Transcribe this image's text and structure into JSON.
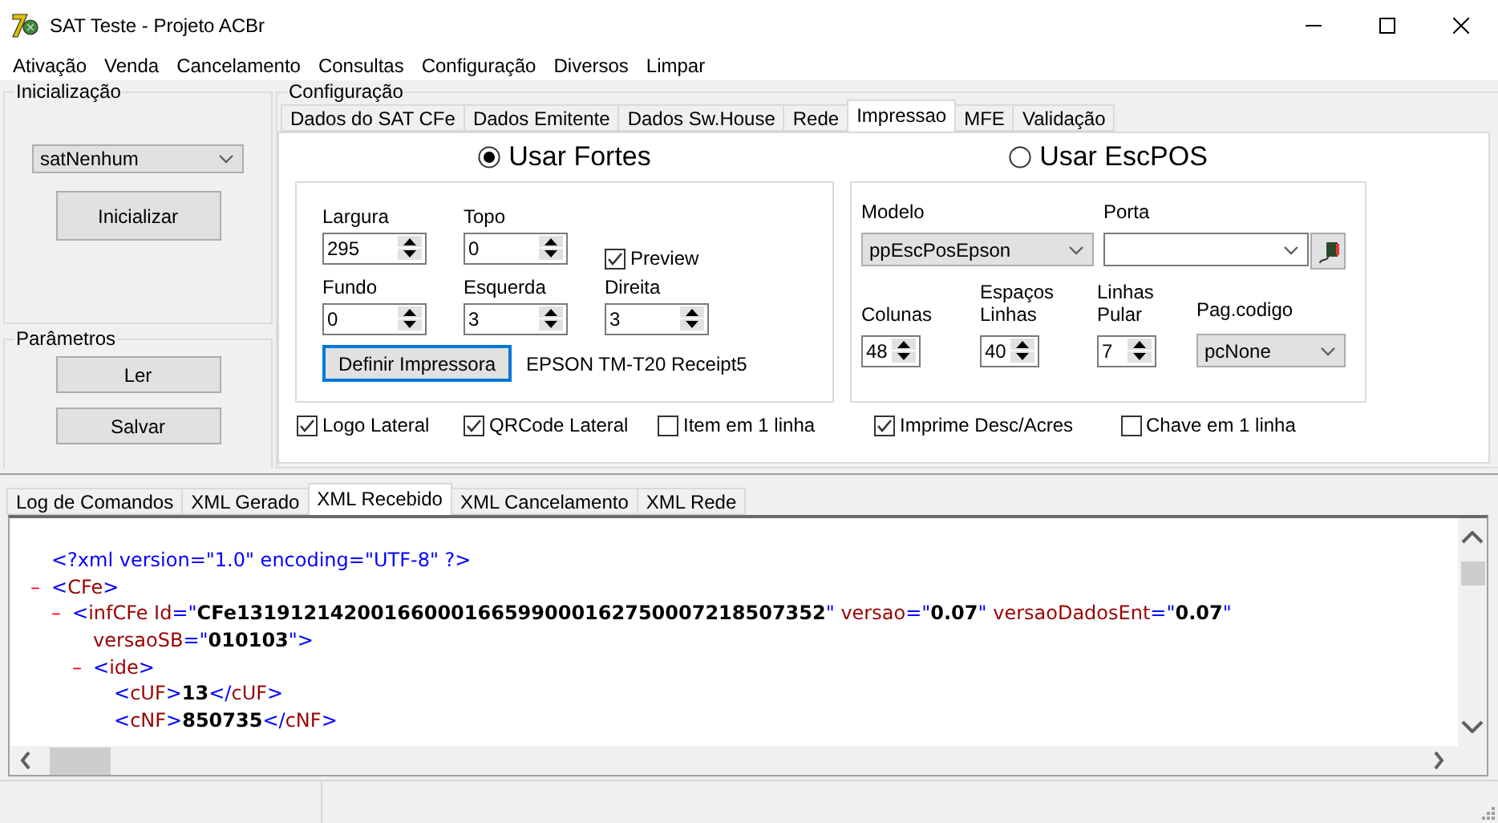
{
  "window": {
    "title": "SAT Teste - Projeto ACBr"
  },
  "menu": [
    "Ativação",
    "Venda",
    "Cancelamento",
    "Consultas",
    "Configuração",
    "Diversos",
    "Limpar"
  ],
  "initialization": {
    "title": "Inicialização",
    "model": "satNenhum",
    "button": "Inicializar"
  },
  "parameters": {
    "title": "Parâmetros",
    "buttons": [
      "Ler",
      "Salvar"
    ]
  },
  "configuration": {
    "title": "Configuração",
    "tabs": [
      {
        "label": "Dados do SAT CFe",
        "selected": false
      },
      {
        "label": "Dados Emitente",
        "selected": false
      },
      {
        "label": "Dados Sw.House",
        "selected": false
      },
      {
        "label": "Rede",
        "selected": false
      },
      {
        "label": "Impressao",
        "selected": true
      },
      {
        "label": "MFE",
        "selected": false
      },
      {
        "label": "Validação",
        "selected": false
      }
    ],
    "fortes": {
      "label": "Usar Fortes",
      "selected": true,
      "fields": [
        {
          "kind": "spin",
          "label": "Largura",
          "value": "295"
        },
        {
          "kind": "spin",
          "label": "Topo",
          "value": "0"
        },
        {
          "kind": "check",
          "label": "Preview",
          "checked": true
        },
        {
          "kind": "spin",
          "label": "Fundo",
          "value": "0"
        },
        {
          "kind": "spin",
          "label": "Esquerda",
          "value": "3"
        },
        {
          "kind": "spin",
          "label": "Direita",
          "value": "3"
        }
      ],
      "printer_button": "Definir Impressora",
      "printer_name": "EPSON TM-T20 Receipt5",
      "options": [
        {
          "label": "Logo Lateral",
          "checked": true
        },
        {
          "label": "QRCode Lateral",
          "checked": true
        },
        {
          "label": "Item em 1 linha",
          "checked": false
        }
      ]
    },
    "escpos": {
      "label": "Usar EscPOS",
      "selected": false,
      "model_label": "Modelo",
      "model": "ppEscPosEpson",
      "port_label": "Porta",
      "spinners": [
        {
          "label": "Colunas",
          "value": "48"
        },
        {
          "label": "Espaços Linhas",
          "value": "40"
        },
        {
          "label": "Linhas Pular",
          "value": "7"
        }
      ],
      "codepage_label": "Pag.codigo",
      "codepage": "pcNone",
      "options": [
        {
          "label": "Imprime Desc/Acres",
          "checked": true
        },
        {
          "label": "Chave em 1 linha",
          "checked": false
        }
      ]
    }
  },
  "log_tabs": [
    {
      "label": "Log de Comandos",
      "selected": false
    },
    {
      "label": "XML Gerado",
      "selected": false
    },
    {
      "label": "XML Recebido",
      "selected": true
    },
    {
      "label": "XML Cancelamento",
      "selected": false
    },
    {
      "label": "XML Rede",
      "selected": false
    }
  ],
  "xml": [
    {
      "lines": [
        [
          {
            "kind": "punct",
            "text": "<?xml version=\"1.0\" encoding=\"UTF-8\" ?>"
          }
        ]
      ]
    },
    {
      "toggle": "–",
      "lines": [
        [
          {
            "kind": "punct",
            "text": "<"
          },
          {
            "kind": "name",
            "text": "CFe"
          },
          {
            "kind": "punct",
            "text": ">"
          }
        ]
      ],
      "children": [
        {
          "toggle": "–",
          "lines": [
            [
              {
                "kind": "punct",
                "text": "<"
              },
              {
                "kind": "name",
                "text": "infCFe Id"
              },
              {
                "kind": "punct",
                "text": "=\""
              },
              {
                "kind": "value",
                "text": "CFe13191214200166000166599000162750007218507352"
              },
              {
                "kind": "punct",
                "text": "\""
              },
              {
                "kind": "name",
                "text": " versao"
              },
              {
                "kind": "punct",
                "text": "=\""
              },
              {
                "kind": "value",
                "text": "0.07"
              },
              {
                "kind": "punct",
                "text": "\""
              },
              {
                "kind": "name",
                "text": " versaoDadosEnt"
              },
              {
                "kind": "punct",
                "text": "=\""
              },
              {
                "kind": "value",
                "text": "0.07"
              },
              {
                "kind": "punct",
                "text": "\""
              }
            ],
            [
              {
                "kind": "name",
                "text": "versaoSB"
              },
              {
                "kind": "punct",
                "text": "=\""
              },
              {
                "kind": "value",
                "text": "010103"
              },
              {
                "kind": "punct",
                "text": "\">"
              }
            ]
          ],
          "children": [
            {
              "toggle": "–",
              "lines": [
                [
                  {
                    "kind": "punct",
                    "text": "<"
                  },
                  {
                    "kind": "name",
                    "text": "ide"
                  },
                  {
                    "kind": "punct",
                    "text": ">"
                  }
                ]
              ],
              "children": [
                {
                  "lines": [
                    [
                      {
                        "kind": "punct",
                        "text": "<"
                      },
                      {
                        "kind": "name",
                        "text": "cUF"
                      },
                      {
                        "kind": "punct",
                        "text": ">"
                      },
                      {
                        "kind": "value",
                        "text": "13"
                      },
                      {
                        "kind": "punct",
                        "text": "</"
                      },
                      {
                        "kind": "name",
                        "text": "cUF"
                      },
                      {
                        "kind": "punct",
                        "text": ">"
                      }
                    ]
                  ]
                },
                {
                  "lines": [
                    [
                      {
                        "kind": "punct",
                        "text": "<"
                      },
                      {
                        "kind": "name",
                        "text": "cNF"
                      },
                      {
                        "kind": "punct",
                        "text": ">"
                      },
                      {
                        "kind": "value",
                        "text": "850735"
                      },
                      {
                        "kind": "punct",
                        "text": "</"
                      },
                      {
                        "kind": "name",
                        "text": "cNF"
                      },
                      {
                        "kind": "punct",
                        "text": ">"
                      }
                    ]
                  ]
                }
              ]
            }
          ]
        }
      ]
    }
  ]
}
